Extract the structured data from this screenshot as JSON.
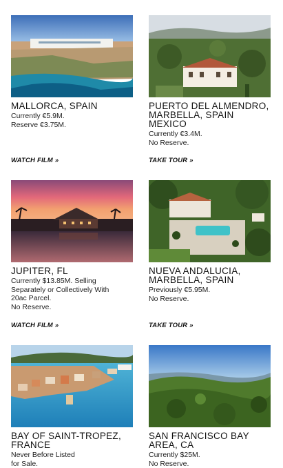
{
  "listings": [
    {
      "title": "MALLORCA, SPAIN",
      "details": "Currently €5.9M.\nReserve €3.75M.",
      "cta": "WATCH FILM »",
      "image": "mallorca-coastal-villa-photo"
    },
    {
      "title": "PUERTO DEL ALMENDRO,\nMARBELLA, SPAIN\nMEXICO",
      "details": "Currently €3.4M.\nNo Reserve.",
      "cta": "TAKE TOUR »",
      "image": "marbella-estate-photo"
    },
    {
      "title": "JUPITER, FL",
      "details": "Currently $13.85M. Selling\nSeparately or Collectively With\n20ac Parcel.\nNo Reserve.",
      "cta": "WATCH FILM »",
      "image": "jupiter-sunset-estate-photo"
    },
    {
      "title": "NUEVA ANDALUCIA,\nMARBELLA, SPAIN",
      "details": "Previously €5.95M.\nNo Reserve.",
      "cta": "TAKE TOUR »",
      "image": "nueva-andalucia-pool-villa-photo"
    },
    {
      "title": "BAY OF SAINT-TROPEZ,\nFRANCE",
      "details": "Never Before Listed\nfor Sale.",
      "cta": "",
      "image": "saint-tropez-bay-photo"
    },
    {
      "title": "SAN FRANCISCO BAY\nAREA, CA",
      "details": "Currently $25M.\nNo Reserve.",
      "cta": "",
      "image": "san-francisco-hills-photo"
    }
  ]
}
